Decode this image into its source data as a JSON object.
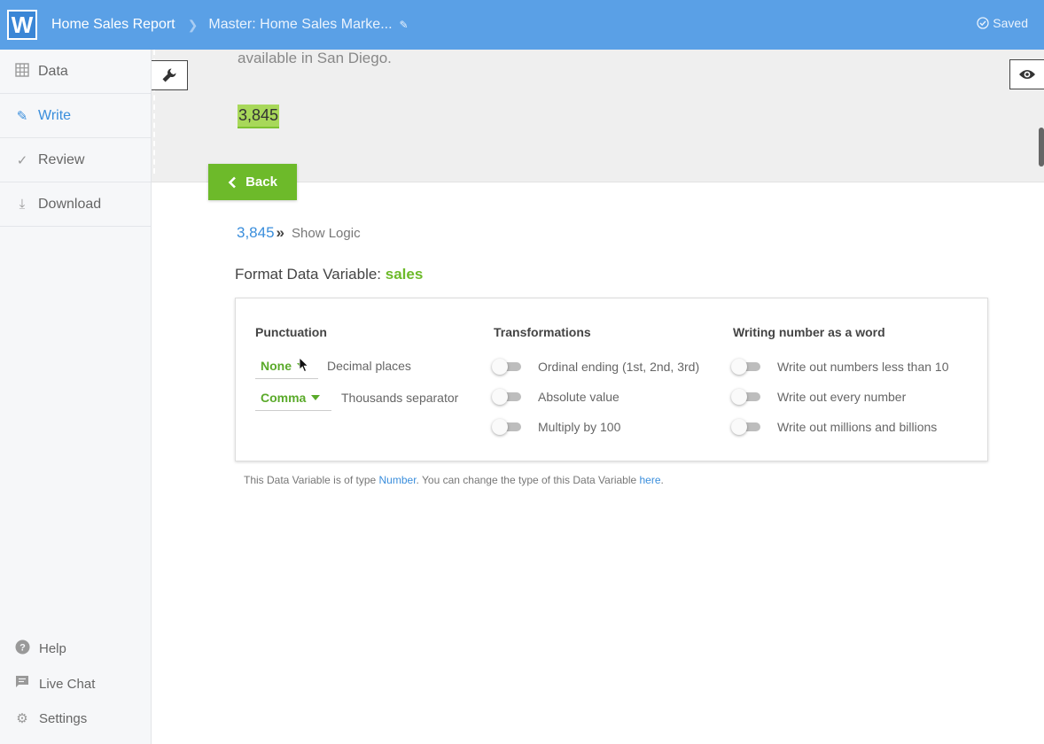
{
  "app": {
    "logo_letter": "W",
    "report_name": "Home Sales Report",
    "section_name": "Master: Home Sales Marke...",
    "save_status": "Saved"
  },
  "sidebar": {
    "items": [
      {
        "label": "Data",
        "icon": "grid-icon"
      },
      {
        "label": "Write",
        "icon": "pencil-icon",
        "active": true
      },
      {
        "label": "Review",
        "icon": "check-icon"
      },
      {
        "label": "Download",
        "icon": "download-icon"
      }
    ],
    "footer": [
      {
        "label": "Help",
        "icon": "help-icon"
      },
      {
        "label": "Live Chat",
        "icon": "chat-icon"
      },
      {
        "label": "Settings",
        "icon": "gear-icon"
      }
    ]
  },
  "preview": {
    "text": "available in San Diego.",
    "value": "3,845"
  },
  "back_label": "Back",
  "logic": {
    "value": "3,845",
    "separator": "»",
    "link": "Show Logic"
  },
  "format": {
    "title": "Format Data Variable: ",
    "variable": "sales"
  },
  "punctuation": {
    "heading": "Punctuation",
    "decimal_value": "None",
    "decimal_label": "Decimal places",
    "thousands_value": "Comma",
    "thousands_label": "Thousands separator"
  },
  "transformations": {
    "heading": "Transformations",
    "options": [
      {
        "label": "Ordinal ending (1st, 2nd, 3rd)",
        "on": false
      },
      {
        "label": "Absolute value",
        "on": false
      },
      {
        "label": "Multiply by 100",
        "on": false
      }
    ]
  },
  "words": {
    "heading": "Writing number as a word",
    "options": [
      {
        "label": "Write out numbers less than 10",
        "on": false
      },
      {
        "label": "Write out every number",
        "on": false
      },
      {
        "label": "Write out millions and billions",
        "on": false
      }
    ]
  },
  "note": {
    "prefix": "This Data Variable is of type ",
    "type_link": "Number",
    "middle": ". You can change the type of this Data Variable ",
    "here_link": "here",
    "suffix": "."
  },
  "colors": {
    "topbar": "#5aa0e6",
    "accent_blue": "#3a8edc",
    "accent_green": "#6dba2a"
  }
}
